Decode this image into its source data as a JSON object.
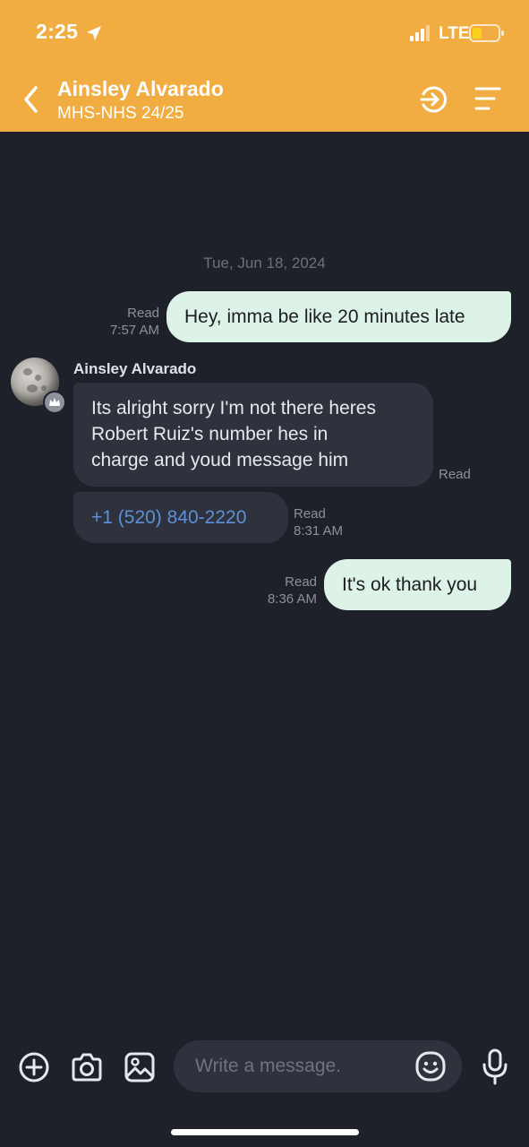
{
  "status_bar": {
    "time": "2:25",
    "network": "LTE"
  },
  "header": {
    "contact_name": "Ainsley Alvarado",
    "subtitle": "MHS-NHS 24/25"
  },
  "conversation": {
    "date_separator": "Tue, Jun 18, 2024",
    "messages": [
      {
        "direction": "outgoing",
        "text": "Hey, imma be like 20 minutes late",
        "status": "Read",
        "time": "7:57 AM"
      },
      {
        "direction": "incoming",
        "sender": "Ainsley Alvarado",
        "lines": [
          "Its alright sorry I'm not there heres",
          "Robert Ruiz's number hes in",
          "charge and youd message him"
        ],
        "status": "Read"
      },
      {
        "direction": "incoming",
        "text": "+1 (520) 840-2220",
        "status": "Read",
        "time": "8:31 AM"
      },
      {
        "direction": "outgoing",
        "text": "It's ok thank you",
        "status": "Read",
        "time": "8:36 AM"
      }
    ]
  },
  "composer": {
    "placeholder": "Write a message."
  },
  "icons": {
    "header": [
      "back-chevron-icon",
      "join-arrow-icon",
      "menu-lines-icon"
    ],
    "composer": [
      "plus-circle-icon",
      "camera-icon",
      "image-icon",
      "emoji-icon",
      "microphone-icon"
    ]
  },
  "colors": {
    "header_bg": "#f2ad42",
    "chat_bg": "#1e2129",
    "outgoing_bubble": "#ddf3e8",
    "incoming_bubble": "#2e323d",
    "link": "#5f8fd6"
  }
}
